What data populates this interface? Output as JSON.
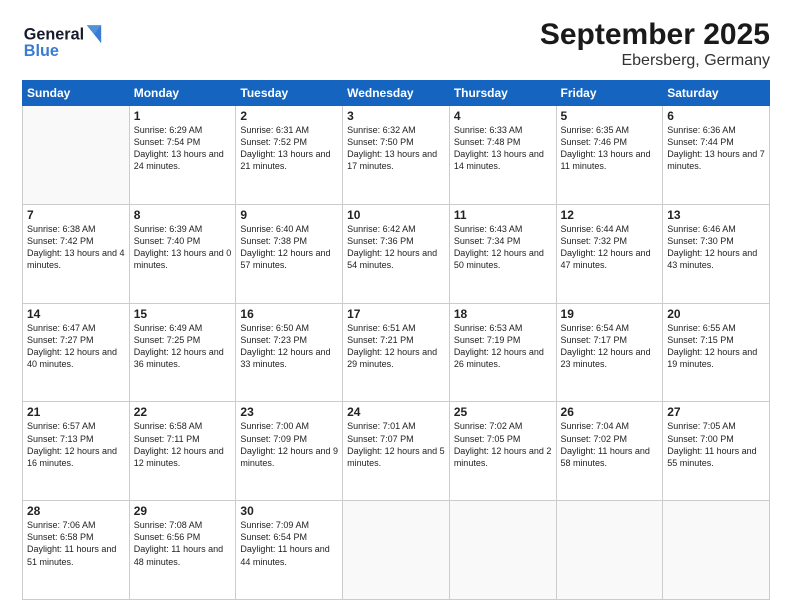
{
  "header": {
    "logo_line1": "General",
    "logo_line2": "Blue",
    "title": "September 2025",
    "subtitle": "Ebersberg, Germany"
  },
  "days_of_week": [
    "Sunday",
    "Monday",
    "Tuesday",
    "Wednesday",
    "Thursday",
    "Friday",
    "Saturday"
  ],
  "weeks": [
    [
      {
        "date": "",
        "info": ""
      },
      {
        "date": "1",
        "info": "Sunrise: 6:29 AM\nSunset: 7:54 PM\nDaylight: 13 hours\nand 24 minutes."
      },
      {
        "date": "2",
        "info": "Sunrise: 6:31 AM\nSunset: 7:52 PM\nDaylight: 13 hours\nand 21 minutes."
      },
      {
        "date": "3",
        "info": "Sunrise: 6:32 AM\nSunset: 7:50 PM\nDaylight: 13 hours\nand 17 minutes."
      },
      {
        "date": "4",
        "info": "Sunrise: 6:33 AM\nSunset: 7:48 PM\nDaylight: 13 hours\nand 14 minutes."
      },
      {
        "date": "5",
        "info": "Sunrise: 6:35 AM\nSunset: 7:46 PM\nDaylight: 13 hours\nand 11 minutes."
      },
      {
        "date": "6",
        "info": "Sunrise: 6:36 AM\nSunset: 7:44 PM\nDaylight: 13 hours\nand 7 minutes."
      }
    ],
    [
      {
        "date": "7",
        "info": "Sunrise: 6:38 AM\nSunset: 7:42 PM\nDaylight: 13 hours\nand 4 minutes."
      },
      {
        "date": "8",
        "info": "Sunrise: 6:39 AM\nSunset: 7:40 PM\nDaylight: 13 hours\nand 0 minutes."
      },
      {
        "date": "9",
        "info": "Sunrise: 6:40 AM\nSunset: 7:38 PM\nDaylight: 12 hours\nand 57 minutes."
      },
      {
        "date": "10",
        "info": "Sunrise: 6:42 AM\nSunset: 7:36 PM\nDaylight: 12 hours\nand 54 minutes."
      },
      {
        "date": "11",
        "info": "Sunrise: 6:43 AM\nSunset: 7:34 PM\nDaylight: 12 hours\nand 50 minutes."
      },
      {
        "date": "12",
        "info": "Sunrise: 6:44 AM\nSunset: 7:32 PM\nDaylight: 12 hours\nand 47 minutes."
      },
      {
        "date": "13",
        "info": "Sunrise: 6:46 AM\nSunset: 7:30 PM\nDaylight: 12 hours\nand 43 minutes."
      }
    ],
    [
      {
        "date": "14",
        "info": "Sunrise: 6:47 AM\nSunset: 7:27 PM\nDaylight: 12 hours\nand 40 minutes."
      },
      {
        "date": "15",
        "info": "Sunrise: 6:49 AM\nSunset: 7:25 PM\nDaylight: 12 hours\nand 36 minutes."
      },
      {
        "date": "16",
        "info": "Sunrise: 6:50 AM\nSunset: 7:23 PM\nDaylight: 12 hours\nand 33 minutes."
      },
      {
        "date": "17",
        "info": "Sunrise: 6:51 AM\nSunset: 7:21 PM\nDaylight: 12 hours\nand 29 minutes."
      },
      {
        "date": "18",
        "info": "Sunrise: 6:53 AM\nSunset: 7:19 PM\nDaylight: 12 hours\nand 26 minutes."
      },
      {
        "date": "19",
        "info": "Sunrise: 6:54 AM\nSunset: 7:17 PM\nDaylight: 12 hours\nand 23 minutes."
      },
      {
        "date": "20",
        "info": "Sunrise: 6:55 AM\nSunset: 7:15 PM\nDaylight: 12 hours\nand 19 minutes."
      }
    ],
    [
      {
        "date": "21",
        "info": "Sunrise: 6:57 AM\nSunset: 7:13 PM\nDaylight: 12 hours\nand 16 minutes."
      },
      {
        "date": "22",
        "info": "Sunrise: 6:58 AM\nSunset: 7:11 PM\nDaylight: 12 hours\nand 12 minutes."
      },
      {
        "date": "23",
        "info": "Sunrise: 7:00 AM\nSunset: 7:09 PM\nDaylight: 12 hours\nand 9 minutes."
      },
      {
        "date": "24",
        "info": "Sunrise: 7:01 AM\nSunset: 7:07 PM\nDaylight: 12 hours\nand 5 minutes."
      },
      {
        "date": "25",
        "info": "Sunrise: 7:02 AM\nSunset: 7:05 PM\nDaylight: 12 hours\nand 2 minutes."
      },
      {
        "date": "26",
        "info": "Sunrise: 7:04 AM\nSunset: 7:02 PM\nDaylight: 11 hours\nand 58 minutes."
      },
      {
        "date": "27",
        "info": "Sunrise: 7:05 AM\nSunset: 7:00 PM\nDaylight: 11 hours\nand 55 minutes."
      }
    ],
    [
      {
        "date": "28",
        "info": "Sunrise: 7:06 AM\nSunset: 6:58 PM\nDaylight: 11 hours\nand 51 minutes."
      },
      {
        "date": "29",
        "info": "Sunrise: 7:08 AM\nSunset: 6:56 PM\nDaylight: 11 hours\nand 48 minutes."
      },
      {
        "date": "30",
        "info": "Sunrise: 7:09 AM\nSunset: 6:54 PM\nDaylight: 11 hours\nand 44 minutes."
      },
      {
        "date": "",
        "info": ""
      },
      {
        "date": "",
        "info": ""
      },
      {
        "date": "",
        "info": ""
      },
      {
        "date": "",
        "info": ""
      }
    ]
  ]
}
